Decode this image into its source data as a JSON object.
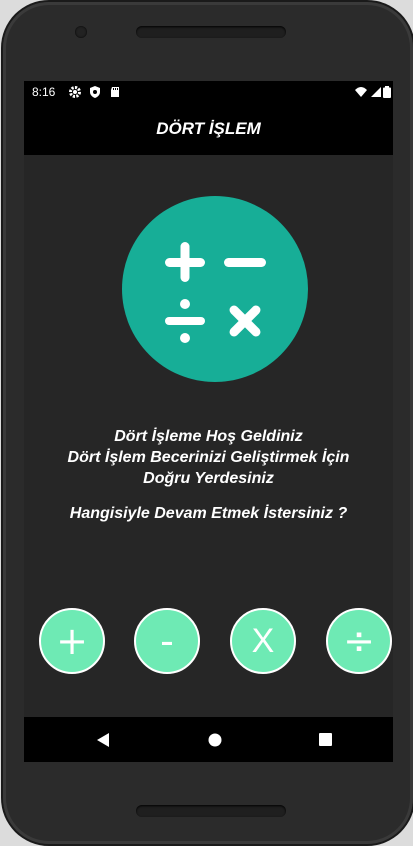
{
  "status": {
    "time": "8:16"
  },
  "app": {
    "title": "DÖRT İŞLEM"
  },
  "welcome": {
    "line1": "Dört İşleme Hoş Geldiniz",
    "line2": "Dört İşlem Becerinizi Geliştirmek İçin",
    "line3": "Doğru Yerdesiniz",
    "question": "Hangisiyle Devam Etmek İstersiniz ?"
  },
  "operations": {
    "add": "+",
    "subtract": "-",
    "multiply": "X",
    "divide": "÷"
  },
  "colors": {
    "hero": "#17ae97",
    "button": "#6eeab4",
    "background": "#262626"
  },
  "icons": [
    "settings-icon",
    "shield-icon",
    "sd-card-icon",
    "wifi-icon",
    "signal-icon",
    "battery-icon",
    "back-icon",
    "home-icon",
    "recents-icon"
  ]
}
